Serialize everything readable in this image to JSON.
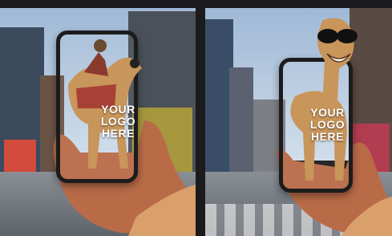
{
  "left_panel": {
    "logo_line1": "YOUR",
    "logo_line2": "LOGO",
    "logo_line3": "HERE"
  },
  "right_panel": {
    "logo_line1": "YOUR",
    "logo_line2": "LOGO",
    "logo_line3": "HERE"
  },
  "colors": {
    "background": "#1b1b1d",
    "phone_frame": "#1c1c1c",
    "camel": "#c8955a",
    "hand_skin": "#b96b47",
    "sleeve": "#d9a06c"
  }
}
